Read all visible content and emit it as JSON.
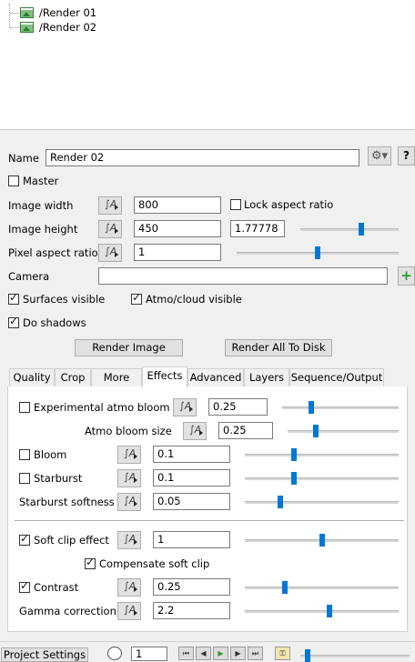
{
  "tree": {
    "items": [
      {
        "label": "/Render 01",
        "icon": "image-icon"
      },
      {
        "label": "/Render 02",
        "icon": "image-icon"
      }
    ]
  },
  "form": {
    "name_label": "Name",
    "name_value": "Render 02",
    "master_label": "Master",
    "master_checked": false,
    "image_width_label": "Image width",
    "image_width_value": "800",
    "lock_aspect_label": "Lock aspect ratio",
    "lock_aspect_checked": false,
    "image_height_label": "Image height",
    "image_height_value": "450",
    "aspect_value": "1.77778",
    "aspect_slider": 0.62,
    "pixel_aspect_label": "Pixel aspect ratio",
    "pixel_aspect_value": "1",
    "pixel_aspect_slider": 0.5,
    "camera_label": "Camera",
    "camera_value": "",
    "surfaces_label": "Surfaces visible",
    "surfaces_checked": true,
    "atmo_label": "Atmo/cloud visible",
    "atmo_checked": true,
    "shadows_label": "Do shadows",
    "shadows_checked": true,
    "render_image_label": "Render Image",
    "render_all_label": "Render All To Disk"
  },
  "tabs": [
    "Quality",
    "Crop",
    "More",
    "Effects",
    "Advanced",
    "Layers",
    "Sequence/Output"
  ],
  "active_tab": "Effects",
  "effects": {
    "exp_bloom_label": "Experimental atmo bloom",
    "exp_bloom_checked": false,
    "exp_bloom_value": "0.25",
    "exp_bloom_slider": 0.25,
    "atmo_bloom_size_label": "Atmo bloom size",
    "atmo_bloom_size_value": "0.25",
    "atmo_bloom_size_slider": 0.25,
    "bloom_label": "Bloom",
    "bloom_checked": false,
    "bloom_value": "0.1",
    "bloom_slider": 0.32,
    "starburst_label": "Starburst",
    "starburst_checked": false,
    "starburst_value": "0.1",
    "starburst_slider": 0.32,
    "starburst_softness_label": "Starburst softness",
    "starburst_softness_value": "0.05",
    "starburst_softness_slider": 0.23,
    "soft_clip_label": "Soft clip effect",
    "soft_clip_checked": true,
    "soft_clip_value": "1",
    "soft_clip_slider": 0.5,
    "compensate_label": "Compensate soft clip",
    "compensate_checked": true,
    "contrast_label": "Contrast",
    "contrast_checked": true,
    "contrast_value": "0.25",
    "contrast_slider": 0.26,
    "gamma_label": "Gamma correction",
    "gamma_value": "2.2",
    "gamma_slider": 0.55
  },
  "bottom": {
    "project_settings_label": "Project Settings",
    "frame_value": "1"
  }
}
